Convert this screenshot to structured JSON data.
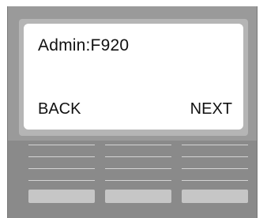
{
  "screen": {
    "title": "Admin:F920",
    "softkey_left": "BACK",
    "softkey_right": "NEXT"
  },
  "colors": {
    "device_body": "#8a8a8a",
    "screen_background": "#ffffff",
    "text": "#111111"
  }
}
